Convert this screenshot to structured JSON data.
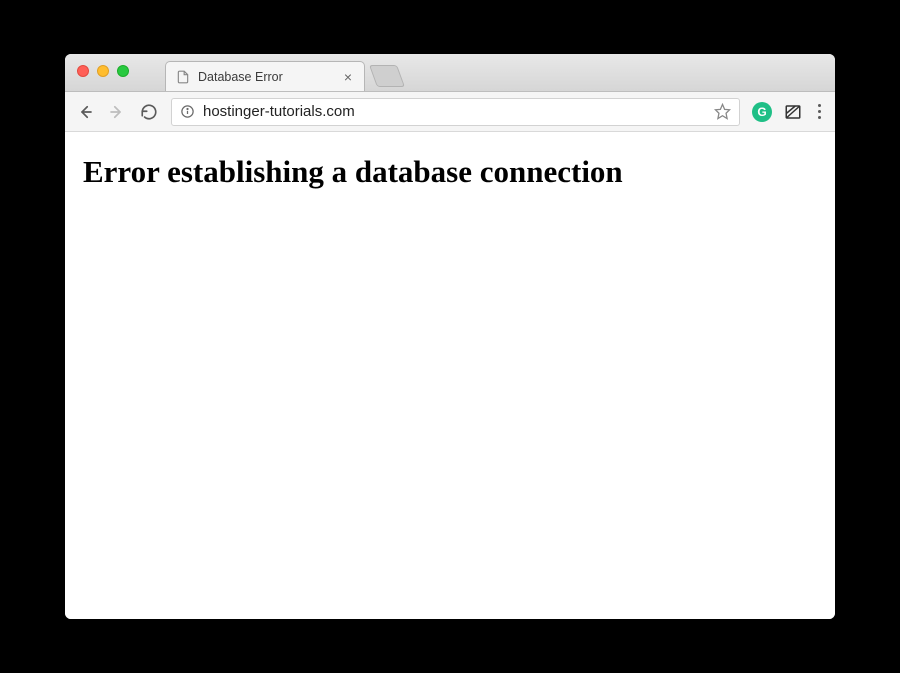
{
  "window": {
    "tab": {
      "title": "Database Error"
    }
  },
  "toolbar": {
    "url": "hostinger-tutorials.com",
    "grammarly_label": "G"
  },
  "page": {
    "heading": "Error establishing a database connection"
  }
}
